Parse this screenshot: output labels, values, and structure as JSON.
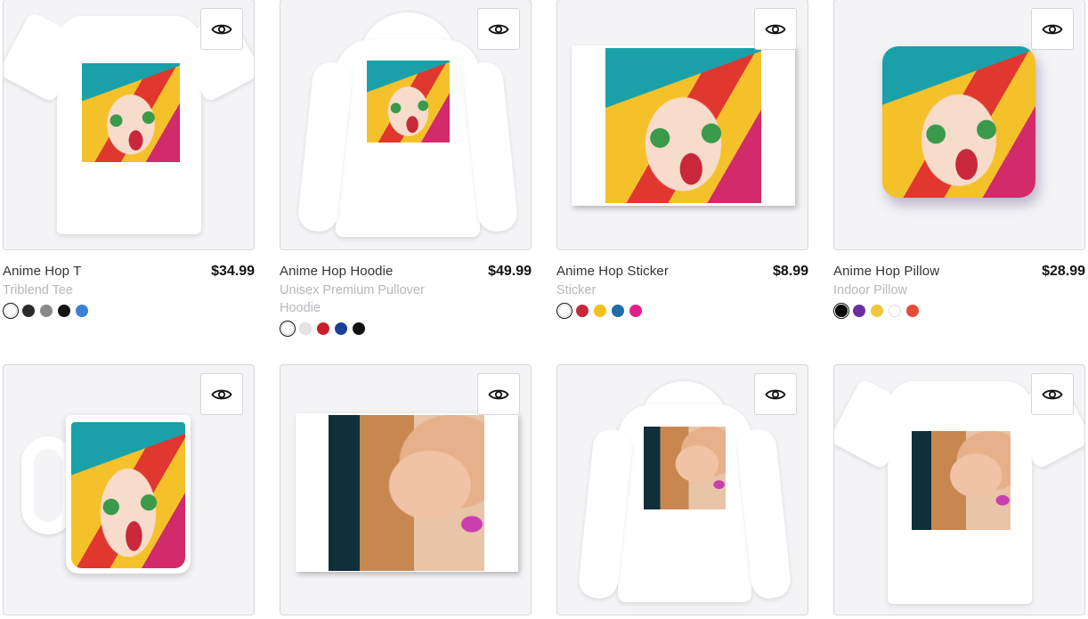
{
  "products": [
    {
      "name": "Anime Hop T",
      "type": "Triblend Tee",
      "price": "$34.99",
      "swatches": [
        "#ffffff",
        "#2b2b2b",
        "#8a8a8a",
        "#141414",
        "#3b7fd6"
      ],
      "selected": 0
    },
    {
      "name": "Anime Hop Hoodie",
      "type": "Unisex Premium Pullover Hoodie",
      "price": "$49.99",
      "swatches": [
        "#ffffff",
        "#e8e3dc",
        "#c81f2b",
        "#1b3f95",
        "#111111"
      ],
      "selected": 0
    },
    {
      "name": "Anime Hop Sticker",
      "type": "Sticker",
      "price": "$8.99",
      "swatches": [
        "#ffffff",
        "#c8283a",
        "#f2c21a",
        "#1a6fa6",
        "#e61e8c"
      ],
      "selected": 0
    },
    {
      "name": "Anime Hop Pillow",
      "type": "Indoor Pillow",
      "price": "$28.99",
      "swatches": [
        "#000000",
        "#6b2fa0",
        "#f0c93a",
        "#ffffff",
        "#e64a3a"
      ],
      "selected": 0
    }
  ],
  "bottom_products": [
    {
      "image": "anime mug"
    },
    {
      "image": "photo print"
    },
    {
      "image": "photo hoodie"
    },
    {
      "image": "photo tee"
    }
  ],
  "icons": {
    "quick_view": "eye-icon"
  }
}
